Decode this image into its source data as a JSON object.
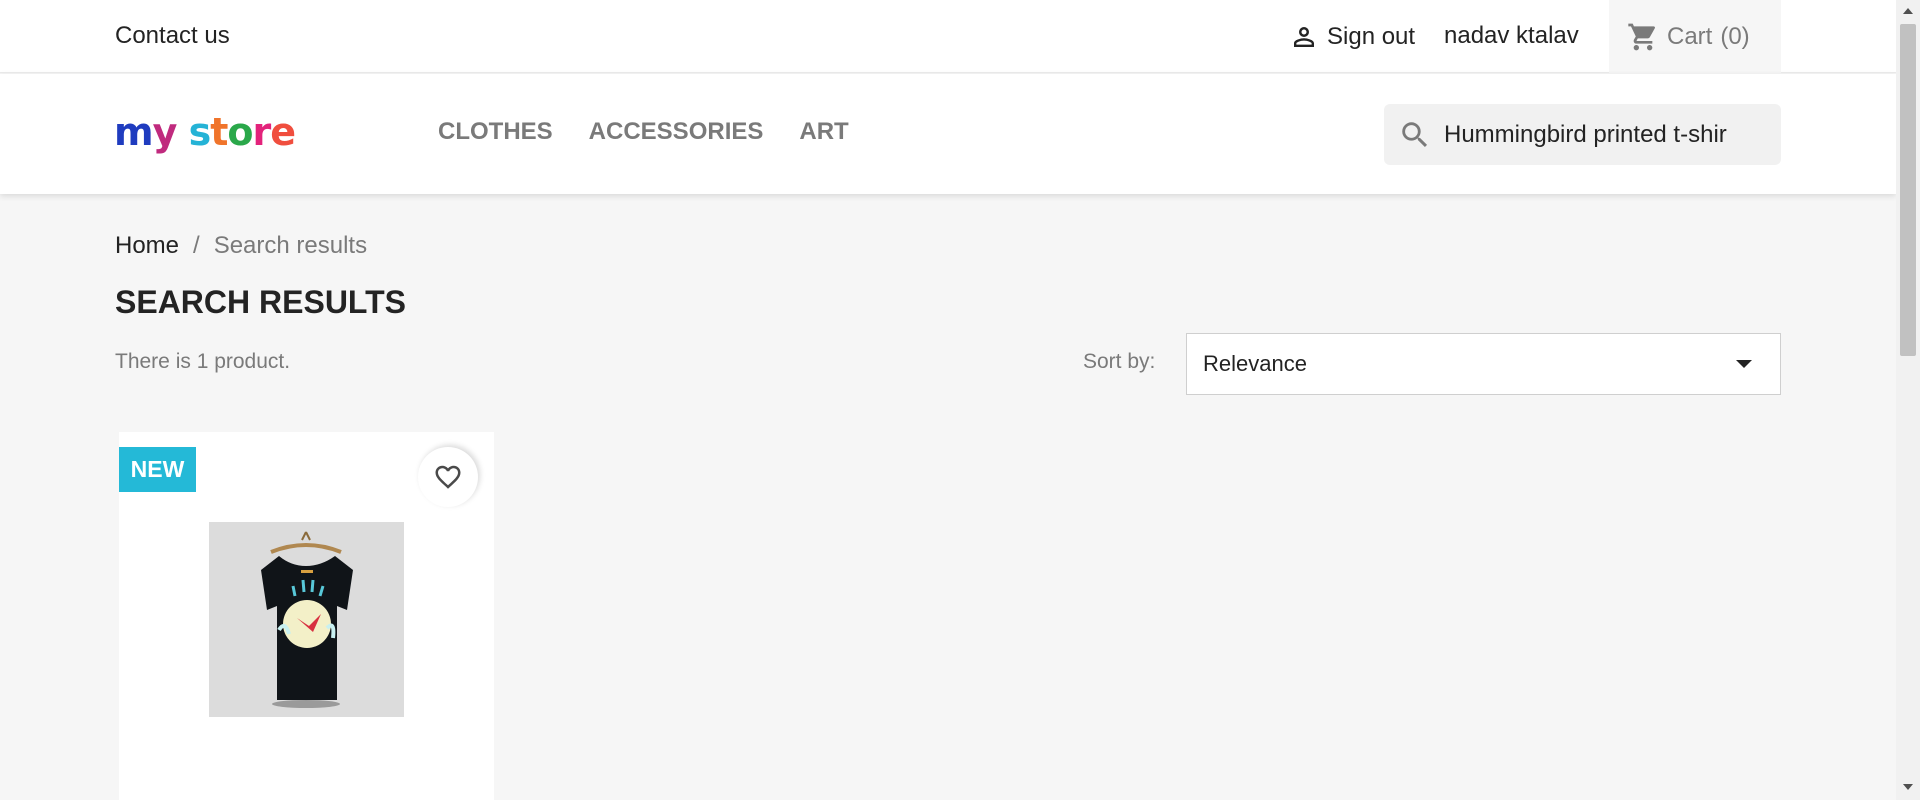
{
  "topbar": {
    "contact_label": "Contact us",
    "signout_label": "Sign out",
    "username": "nadav ktalav",
    "cart_label": "Cart",
    "cart_count": "(0)"
  },
  "header": {
    "logo_letters": [
      "m",
      "y",
      " ",
      "s",
      "t",
      "o",
      "r",
      "e"
    ],
    "logo_colors": [
      "#1f3cbf",
      "#c02a7e",
      "#ffffff",
      "#25b3d6",
      "#f0742b",
      "#2aa84a",
      "#e3237b",
      "#f04e3e"
    ],
    "nav": [
      "CLOTHES",
      "ACCESSORIES",
      "ART"
    ],
    "search_value": "Hummingbird printed t-shir"
  },
  "breadcrumb": {
    "home": "Home",
    "separator": "/",
    "current": "Search results"
  },
  "main": {
    "title": "SEARCH RESULTS",
    "count": "There is 1 product.",
    "sort_label": "Sort by:",
    "sort_value": "Relevance"
  },
  "product": {
    "badge": "NEW",
    "badge_color": "#24b9d7"
  },
  "icons": {
    "account": "person-icon",
    "cart": "shopping-cart-icon",
    "search": "search-icon",
    "wishlist": "heart-icon",
    "sort": "caret-down-icon"
  }
}
